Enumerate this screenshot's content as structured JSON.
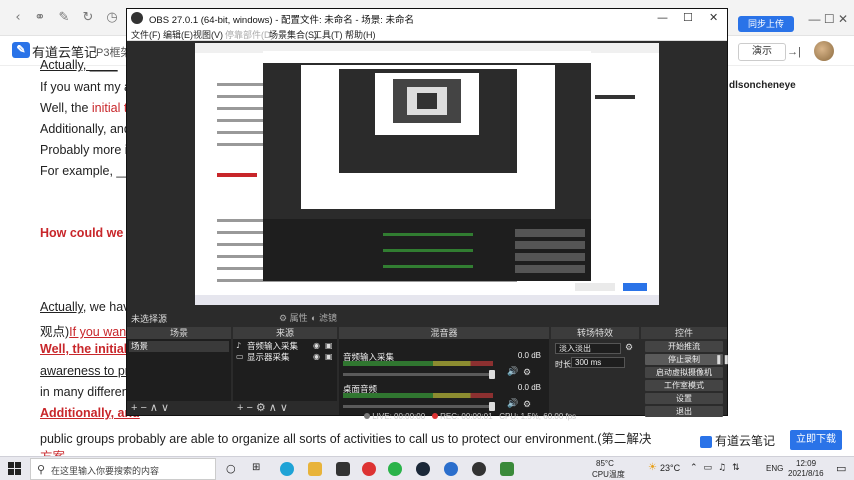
{
  "note": {
    "app_name": "有道云笔记",
    "doc_tab": "P3框架",
    "present": "演示",
    "sync": "同步上传",
    "author": "dlsoncheneye",
    "lines": [
      {
        "a": "Actually, ____",
        "b": "",
        "c": ""
      },
      {
        "a": "If you want my a",
        "b": "",
        "c": ""
      },
      {
        "a": "Well, the ",
        "b": "initial t",
        "c": ""
      },
      {
        "a": "Additionally, and",
        "b": "",
        "c": ""
      },
      {
        "a": "Probably more i",
        "b": "",
        "c": ""
      },
      {
        "a": "For example, ___",
        "b": "",
        "c": ""
      }
    ],
    "heading": "How could we c",
    "lower_lines": [
      {
        "a": "Actually",
        "b": ", we hav",
        "red": false
      },
      {
        "a": "观点)",
        "b": "If you want",
        "red": true
      },
      {
        "a": "Well, the initial t",
        "b": "",
        "red": true
      },
      {
        "a": "awareness to pr",
        "b": "",
        "red": false
      },
      {
        "a": "in many differen",
        "b": "",
        "red": false
      },
      {
        "a": "Additionally, and",
        "b": "",
        "red": true
      }
    ],
    "last_line": "public groups probably are able to organize all sorts of activities to call us to protect our environment.(第二解决",
    "last_line2": "方案",
    "ad_logo": "有道云笔记",
    "ad_button": "立即下载"
  },
  "obs": {
    "title": "OBS 27.0.1 (64-bit, windows) - 配置文件: 未命名 - 场景: 未命名",
    "menu": [
      {
        "label": "文件(F)",
        "disabled": false
      },
      {
        "label": "编辑(E)",
        "disabled": false
      },
      {
        "label": "视图(V)",
        "disabled": false
      },
      {
        "label": "停靠部件(D)",
        "disabled": true
      },
      {
        "label": "场景集合(S)",
        "disabled": false
      },
      {
        "label": "工具(T)",
        "disabled": false
      },
      {
        "label": "帮助(H)",
        "disabled": false
      }
    ],
    "no_source": "未选择源",
    "properties": "属性",
    "filters": "滤镜",
    "scenes": {
      "header": "场景",
      "items": [
        "场景"
      ]
    },
    "sources": {
      "header": "来源",
      "items": [
        "音频输入采集",
        "显示器采集"
      ]
    },
    "mixer": {
      "header": "混音器",
      "tracks": [
        {
          "name": "音频输入采集",
          "db": "0.0 dB"
        },
        {
          "name": "桌面音频",
          "db": "0.0 dB"
        }
      ]
    },
    "transitions": {
      "header": "转场特效",
      "type": "淡入淡出",
      "duration_label": "时长",
      "duration": "300 ms"
    },
    "controls": {
      "header": "控件",
      "buttons": [
        "开始推流",
        "停止录制",
        "启动虚拟摄像机",
        "工作室模式",
        "设置",
        "退出"
      ]
    },
    "status": {
      "live": "LIVE: 00:00:00",
      "rec": "REC: 00:00:01",
      "cpu": "CPU: 1.5%, 60.00 fps"
    }
  },
  "taskbar": {
    "search_placeholder": "在这里输入你要搜索的内容",
    "weather_temp": "85°C",
    "weather_desc": "CPU温度",
    "temp2": "23°C",
    "lang": "ENG",
    "time": "12:09",
    "date": "2021/8/16"
  },
  "colors": {
    "accent": "#2a73e8",
    "red_text": "#c8262a",
    "obs_bg": "#2b2b2b",
    "obs_panel": "#1e1e1e"
  }
}
